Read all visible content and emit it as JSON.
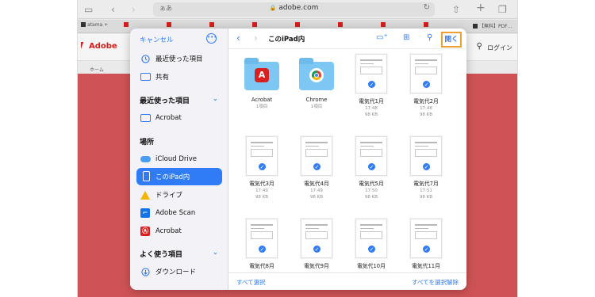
{
  "browser": {
    "address_prefix": "ぁあ",
    "url": "adobe.com",
    "tabs": [
      "atama +",
      "",
      "",
      "",
      "",
      "",
      "",
      "",
      "",
      "【無料】PDF…"
    ]
  },
  "adobe_page": {
    "logo_text": "Adobe",
    "breadcrumb": "ホーム",
    "login": "ログイン"
  },
  "sidebar": {
    "cancel": "キャンセル",
    "top_items": [
      {
        "label": "最近使った項目",
        "icon": "clock-icon"
      },
      {
        "label": "共有",
        "icon": "shared-folder-icon"
      }
    ],
    "recent_section": "最近使った項目",
    "recent_items": [
      {
        "label": "Acrobat",
        "icon": "folder-icon"
      }
    ],
    "locations_section": "場所",
    "locations": [
      {
        "label": "iCloud Drive",
        "icon": "cloud-icon"
      },
      {
        "label": "このiPad内",
        "icon": "ipad-icon",
        "selected": true
      },
      {
        "label": "ドライブ",
        "icon": "google-drive-icon"
      },
      {
        "label": "Adobe Scan",
        "icon": "adobe-scan-icon"
      },
      {
        "label": "Acrobat",
        "icon": "acrobat-icon"
      }
    ],
    "favorites_section": "よく使う項目",
    "favorites": [
      {
        "label": "ダウンロード",
        "icon": "download-icon"
      }
    ]
  },
  "main": {
    "title": "このiPad内",
    "open_label": "開く",
    "select_all": "すべて選択",
    "deselect_all": "すべてを選択解除",
    "folders": [
      {
        "name": "Acrobat",
        "meta": "1項目",
        "badge": "acrobat"
      },
      {
        "name": "Chrome",
        "meta": "1項目",
        "badge": "chrome"
      }
    ],
    "files": [
      {
        "name": "電気代1月",
        "time": "17:48",
        "size": "98 KB"
      },
      {
        "name": "電気代2月",
        "time": "17:48",
        "size": "98 KB"
      },
      {
        "name": "電気代3月",
        "time": "17:49",
        "size": "98 KB"
      },
      {
        "name": "電気代4月",
        "time": "17:49",
        "size": "98 KB"
      },
      {
        "name": "電気代5月",
        "time": "17:50",
        "size": "98 KB"
      },
      {
        "name": "電気代7月",
        "time": "17:51",
        "size": "98 KB"
      },
      {
        "name": "電気代8月",
        "time": "",
        "size": ""
      },
      {
        "name": "電気代9月",
        "time": "",
        "size": ""
      },
      {
        "name": "電気代10月",
        "time": "",
        "size": ""
      },
      {
        "name": "電気代11月",
        "time": "",
        "size": ""
      }
    ]
  },
  "colors": {
    "accent": "#2f7cf6",
    "adobe_red": "#d8575a",
    "highlight": "#f0a030"
  }
}
